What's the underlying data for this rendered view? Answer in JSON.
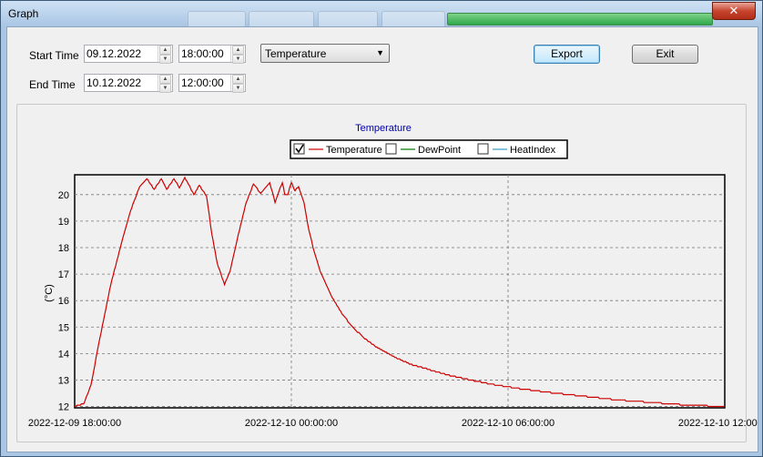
{
  "window": {
    "title": "Graph",
    "close_glyph": "✕"
  },
  "filters": {
    "start_label": "Start Time",
    "start_date": "09.12.2022",
    "start_time": "18:00:00",
    "end_label": "End Time",
    "end_date": "10.12.2022",
    "end_time": "12:00:00",
    "measure_selected": "Temperature"
  },
  "buttons": {
    "export": "Export",
    "exit": "Exit"
  },
  "icons": {
    "spin_up": "chevron-up-icon",
    "spin_down": "chevron-down-icon",
    "dropdown": "dropdown-arrow-icon",
    "close": "close-icon"
  },
  "colors": {
    "temperature": "#cc0000",
    "dewpoint": "#007700",
    "heatindex": "#3399cc",
    "title": "#0000aa"
  },
  "chart_data": {
    "type": "line",
    "title": "Temperature",
    "ylabel": "(°C)",
    "xlabel": "",
    "ylim": [
      11.95,
      20.75
    ],
    "xlim": [
      "2022-12-09 18:00:00",
      "2022-12-10 12:00:00"
    ],
    "x_hours_range": [
      0,
      18
    ],
    "yticks": [
      12,
      13,
      14,
      15,
      16,
      17,
      18,
      19,
      20
    ],
    "xticks": [
      {
        "h": 0,
        "label": "2022-12-09 18:00:00"
      },
      {
        "h": 6,
        "label": "2022-12-10 00:00:00"
      },
      {
        "h": 12,
        "label": "2022-12-10 06:00:00"
      },
      {
        "h": 18,
        "label": "2022-12-10 12:00:00"
      }
    ],
    "grid": true,
    "legend_position": "top-center",
    "legend": [
      {
        "name": "Temperature",
        "checked": true
      },
      {
        "name": "DewPoint",
        "checked": false
      },
      {
        "name": "HeatIndex",
        "checked": false
      }
    ],
    "series": [
      {
        "name": "Temperature",
        "x_hours": [
          0,
          0.25,
          0.45,
          0.7,
          1.0,
          1.3,
          1.55,
          1.8,
          2.0,
          2.2,
          2.4,
          2.55,
          2.75,
          2.9,
          3.05,
          3.3,
          3.45,
          3.65,
          3.8,
          3.95,
          4.15,
          4.3,
          4.5,
          4.75,
          4.95,
          5.15,
          5.4,
          5.55,
          5.65,
          5.75,
          5.82,
          5.9,
          6.0,
          6.1,
          6.2,
          6.35,
          6.45,
          6.6,
          6.8,
          7.1,
          7.4,
          7.7,
          8.0,
          8.4,
          8.8,
          9.3,
          9.8,
          10.3,
          10.8,
          11.5,
          12.2,
          13.0,
          14.0,
          15.0,
          16.0,
          17.0,
          18.0
        ],
        "values": [
          12.0,
          12.1,
          12.8,
          14.6,
          16.6,
          18.2,
          19.4,
          20.3,
          20.6,
          20.2,
          20.6,
          20.2,
          20.6,
          20.25,
          20.65,
          20.0,
          20.35,
          19.95,
          18.5,
          17.4,
          16.6,
          17.1,
          18.3,
          19.7,
          20.4,
          20.05,
          20.45,
          19.7,
          20.1,
          20.45,
          20.0,
          20.0,
          20.45,
          20.15,
          20.3,
          19.7,
          18.9,
          18.0,
          17.1,
          16.2,
          15.5,
          15.0,
          14.6,
          14.2,
          13.9,
          13.6,
          13.4,
          13.2,
          13.05,
          12.85,
          12.7,
          12.55,
          12.4,
          12.25,
          12.15,
          12.05,
          12.0
        ]
      }
    ]
  }
}
